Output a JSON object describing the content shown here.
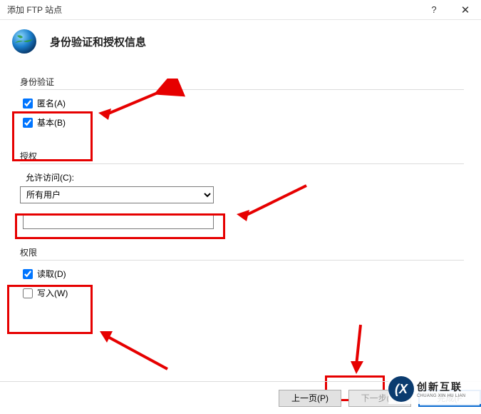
{
  "titlebar": {
    "title": "添加 FTP 站点",
    "help": "?",
    "close": "✕"
  },
  "header": {
    "title": "身份验证和授权信息"
  },
  "auth": {
    "section": "身份验证",
    "anonymous_label": "匿名(A)",
    "anonymous_checked": true,
    "basic_label": "基本(B)",
    "basic_checked": true
  },
  "authorize": {
    "section": "授权",
    "allow_label": "允许访问(C):",
    "selected": "所有用户",
    "options": [
      "所有用户"
    ],
    "extra_value": ""
  },
  "perm": {
    "section": "权限",
    "read_label": "读取(D)",
    "read_checked": true,
    "write_label": "写入(W)",
    "write_checked": false
  },
  "footer": {
    "prev": "上一页(P)",
    "next": "下一步(N)",
    "finish": "完成(F"
  },
  "watermark": {
    "brand_cn": "创新互联",
    "brand_en": "CHUANG XIN HU LIAN",
    "logo": "(X"
  }
}
